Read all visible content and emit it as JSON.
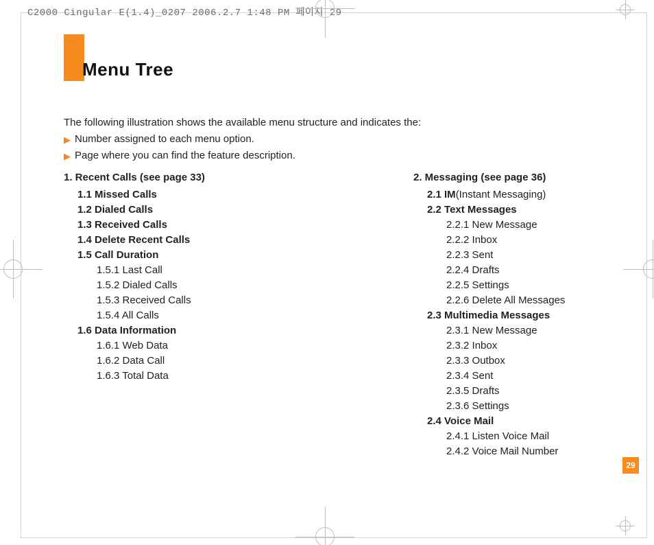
{
  "header": "C2000 Cingular E(1.4)_0207  2006.2.7 1:48 PM 페이지 29",
  "title": "Menu Tree",
  "intro": "The following illustration shows the available menu structure and indicates the:",
  "bullets": [
    "Number assigned to each menu option.",
    "Page where you can find the feature description."
  ],
  "columns": {
    "left": {
      "heading": "1.  Recent Calls (see page 33)",
      "items": [
        {
          "l": 2,
          "t": "1.1 Missed Calls"
        },
        {
          "l": 2,
          "t": "1.2 Dialed Calls"
        },
        {
          "l": 2,
          "t": "1.3 Received Calls"
        },
        {
          "l": 2,
          "t": "1.4 Delete Recent Calls"
        },
        {
          "l": 2,
          "t": "1.5 Call Duration"
        },
        {
          "l": 3,
          "t": "1.5.1 Last Call"
        },
        {
          "l": 3,
          "t": "1.5.2 Dialed Calls"
        },
        {
          "l": 3,
          "t": "1.5.3 Received Calls"
        },
        {
          "l": 3,
          "t": "1.5.4 All Calls"
        },
        {
          "l": 2,
          "t": "1.6 Data Information"
        },
        {
          "l": 3,
          "t": "1.6.1 Web Data"
        },
        {
          "l": 3,
          "t": "1.6.2 Data Call"
        },
        {
          "l": 3,
          "t": "1.6.3 Total Data"
        }
      ]
    },
    "right": {
      "heading": "2.  Messaging (see page 36)",
      "items": [
        {
          "l": 2,
          "t": "2.1 IM",
          "paren": "(Instant Messaging)"
        },
        {
          "l": 2,
          "t": "2.2 Text Messages"
        },
        {
          "l": 3,
          "t": "2.2.1 New Message"
        },
        {
          "l": 3,
          "t": "2.2.2 Inbox"
        },
        {
          "l": 3,
          "t": "2.2.3 Sent"
        },
        {
          "l": 3,
          "t": "2.2.4 Drafts"
        },
        {
          "l": 3,
          "t": "2.2.5 Settings"
        },
        {
          "l": 3,
          "t": "2.2.6 Delete All Messages"
        },
        {
          "l": 2,
          "t": "2.3 Multimedia Messages"
        },
        {
          "l": 3,
          "t": "2.3.1 New Message"
        },
        {
          "l": 3,
          "t": "2.3.2 Inbox"
        },
        {
          "l": 3,
          "t": "2.3.3 Outbox"
        },
        {
          "l": 3,
          "t": "2.3.4 Sent"
        },
        {
          "l": 3,
          "t": "2.3.5 Drafts"
        },
        {
          "l": 3,
          "t": "2.3.6 Settings"
        },
        {
          "l": 2,
          "t": "2.4 Voice Mail"
        },
        {
          "l": 3,
          "t": "2.4.1 Listen  Voice Mail"
        },
        {
          "l": 3,
          "t": "2.4.2 Voice Mail Number"
        }
      ]
    }
  },
  "page_number": "29"
}
